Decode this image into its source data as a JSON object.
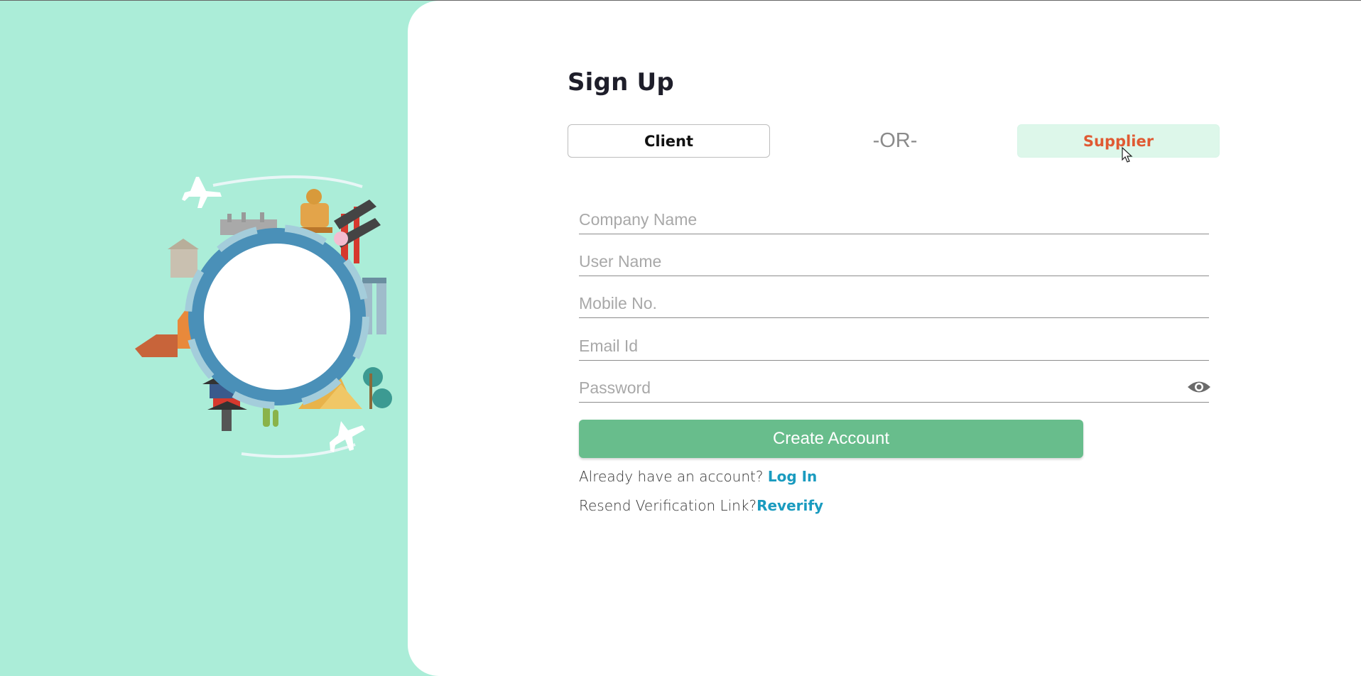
{
  "page": {
    "title": "Sign Up",
    "or_separator": "-OR-"
  },
  "account_type": {
    "client_label": "Client",
    "supplier_label": "Supplier",
    "selected": "Supplier"
  },
  "form": {
    "company_name": {
      "placeholder": "Company Name",
      "value": ""
    },
    "user_name": {
      "placeholder": "User Name",
      "value": ""
    },
    "mobile": {
      "placeholder": "Mobile No.",
      "value": ""
    },
    "email": {
      "placeholder": "Email Id",
      "value": ""
    },
    "password": {
      "placeholder": "Password",
      "value": ""
    },
    "submit_label": "Create Account"
  },
  "footer": {
    "login_prompt": "Already have an account? ",
    "login_link": "Log In",
    "reverify_prompt": "Resend Verification Link?",
    "reverify_link": "Reverify"
  },
  "colors": {
    "left_background": "#abedd8",
    "supplier_text": "#e05a33",
    "supplier_background": "#ddf7ea",
    "create_button": "#68bd8c",
    "link": "#1a9bbf"
  },
  "icons": {
    "password_toggle": "eye-icon",
    "illustration": "world-travel-globe-illustration"
  }
}
